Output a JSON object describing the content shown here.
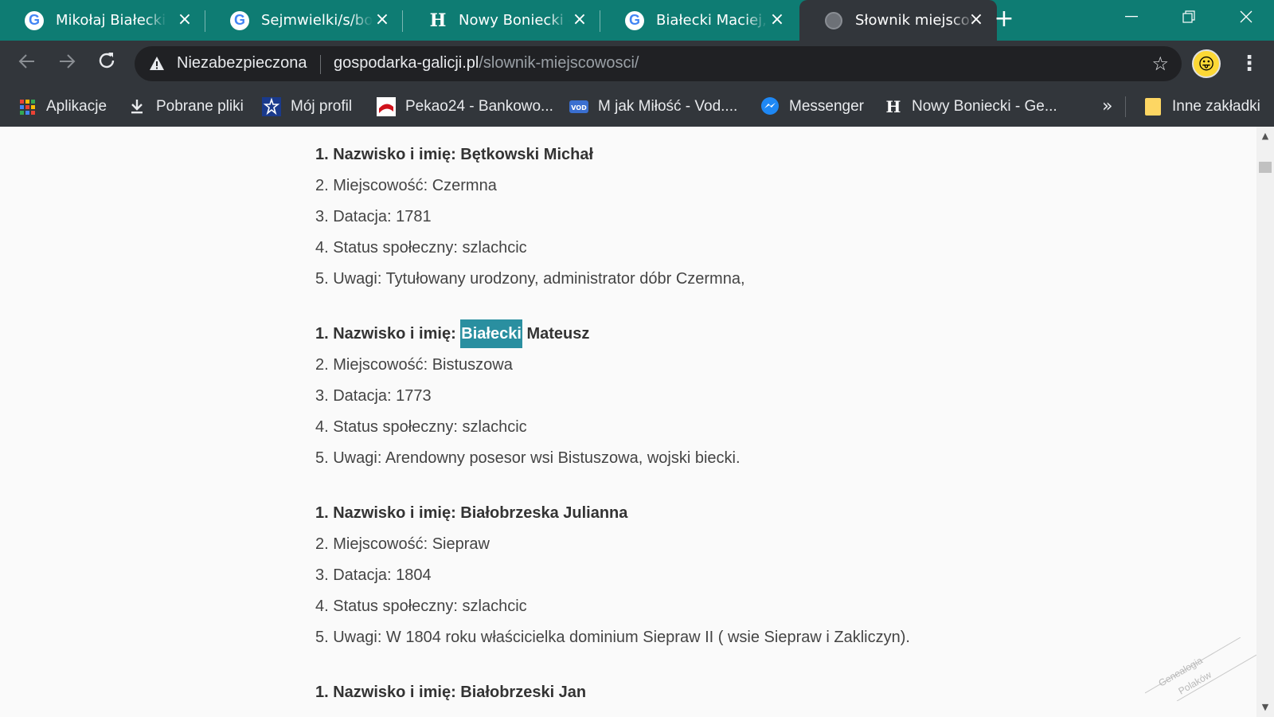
{
  "tabs": [
    {
      "title": "Mikołaj Białecki z",
      "icon": "google-icon"
    },
    {
      "title": "Sejmwielki/s/boni",
      "icon": "google-icon"
    },
    {
      "title": "Nowy Boniecki - G",
      "icon": "h-site-icon"
    },
    {
      "title": "Białecki Maciej, w",
      "icon": "google-icon"
    },
    {
      "title": "Słownik miejscow",
      "icon": "globe-icon",
      "active": true
    }
  ],
  "window_controls": {
    "minimize": "—",
    "restore": "❐",
    "close": "✕"
  },
  "address_bar": {
    "security_label": "Niezabezpieczona",
    "url_host": "gospodarka-galicji.pl",
    "url_path": "/slownik-miejscowosci/"
  },
  "bookmarks": [
    {
      "label": "Aplikacje",
      "icon": "apps-grid-icon"
    },
    {
      "label": "Pobrane pliki",
      "icon": "download-icon"
    },
    {
      "label": "Mój profil",
      "icon": "profile-badge-icon"
    },
    {
      "label": "Pekao24 - Bankowo...",
      "icon": "pekao-icon"
    },
    {
      "label": "M jak Miłość - Vod....",
      "icon": "vod-icon"
    },
    {
      "label": "Messenger",
      "icon": "messenger-icon"
    },
    {
      "label": "Nowy Boniecki - Ge...",
      "icon": "h-site-icon"
    }
  ],
  "other_bookmarks": "Inne zakładki",
  "overflow_label": "»",
  "entries": [
    {
      "name_label": "1. Nazwisko i imię:",
      "name_value": "Bętkowski Michał",
      "place": "2. Miejscowość: Czermna",
      "date": "3. Datacja: 1781",
      "status": "4. Status społeczny: szlachcic",
      "notes": "5. Uwagi: Tytułowany urodzony, administrator dóbr Czermna,"
    },
    {
      "name_label": "1. Nazwisko i imię:",
      "name_highlight": "Białecki",
      "name_rest": "Mateusz",
      "place": "2. Miejscowość: Bistuszowa",
      "date": "3. Datacja: 1773",
      "status": "4. Status społeczny: szlachcic",
      "notes": "5. Uwagi: Arendowny posesor wsi Bistuszowa, wojski biecki."
    },
    {
      "name_label": "1. Nazwisko i imię:",
      "name_value": "Białobrzeska Julianna",
      "place": "2. Miejscowość: Siepraw",
      "date": "3. Datacja: 1804",
      "status": "4. Status społeczny: szlachcic",
      "notes": "5. Uwagi: W 1804 roku właścicielka dominium Siepraw II ( wsie Siepraw i Zakliczyn)."
    },
    {
      "name_label": "1. Nazwisko i imię:",
      "name_value": "Białobrzeski Jan"
    }
  ],
  "watermark": {
    "line1": "Genealogia",
    "line2": "Polaków"
  },
  "colors": {
    "tabstrip": "#0e7c73",
    "toolbar": "#32363b",
    "highlight": "#2a8fa0"
  }
}
